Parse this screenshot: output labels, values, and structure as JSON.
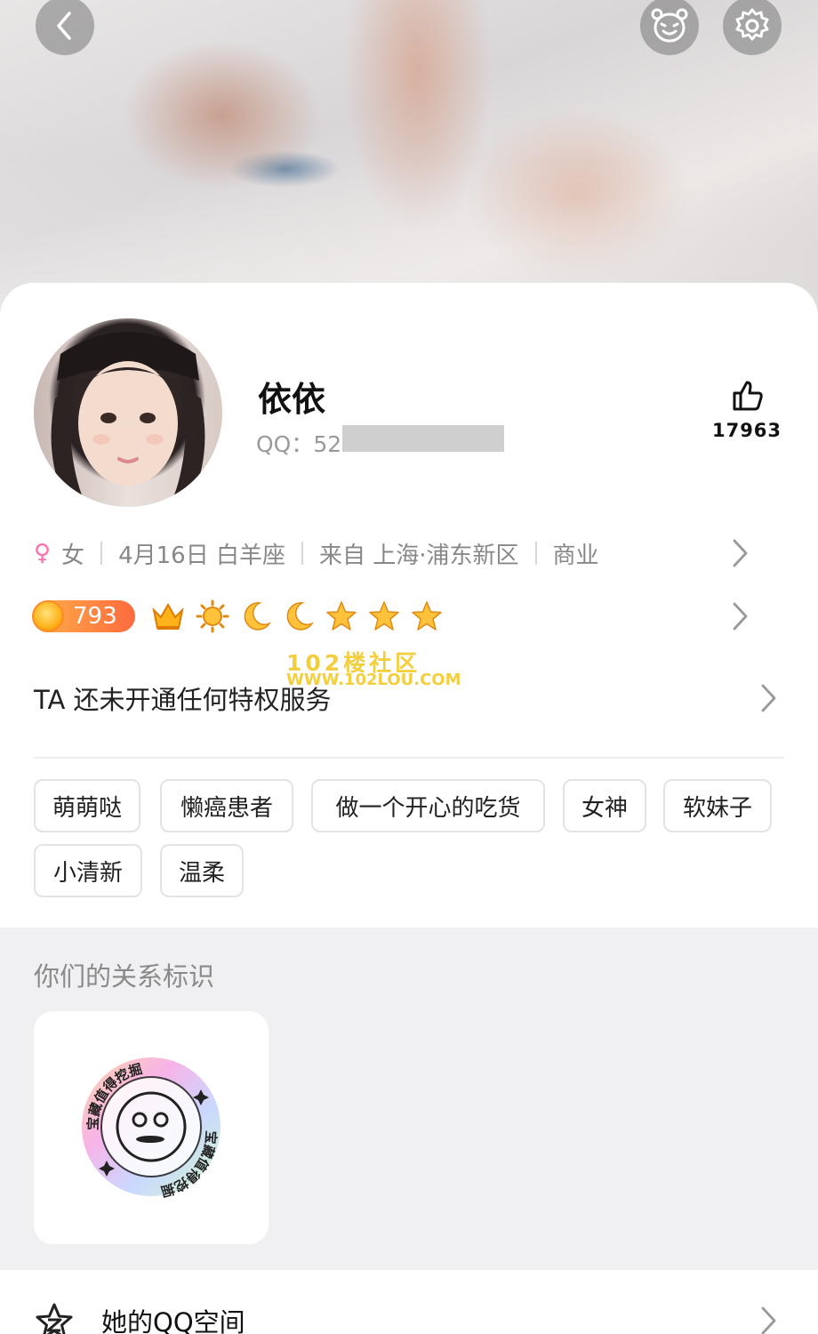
{
  "profile": {
    "name": "依依",
    "qq_label": "QQ：52",
    "like_count": "17963",
    "gender": "女",
    "birthday": "4月16日 白羊座",
    "location": "来自 上海·浦东新区",
    "industry": "商业",
    "level": "793"
  },
  "privilege": "TA 还未开通任何特权服务",
  "watermark": {
    "line1": "102楼社区",
    "line2": "WWW.102LOU.COM"
  },
  "tags": [
    "萌萌哒",
    "懒癌患者",
    "做一个开心的吃货",
    "女神",
    "软妹子",
    "小清新",
    "温柔"
  ],
  "relationship": {
    "title": "你们的关系标识",
    "badge_text": "宝藏值得挖掘"
  },
  "bottom": {
    "qzone_label": "她的QQ空间"
  },
  "colors": {
    "accent_female": "#ff6fae",
    "level_orange": "#ff6a3d",
    "watermark": "#f4cf3d"
  },
  "icons": [
    "back-arrow-icon",
    "bear-face-icon",
    "gear-icon",
    "thumbs-up-icon",
    "female-icon",
    "chevron-right-icon",
    "crown-icon",
    "sun-icon",
    "moon-icon",
    "star-icon",
    "qzone-star-icon"
  ]
}
